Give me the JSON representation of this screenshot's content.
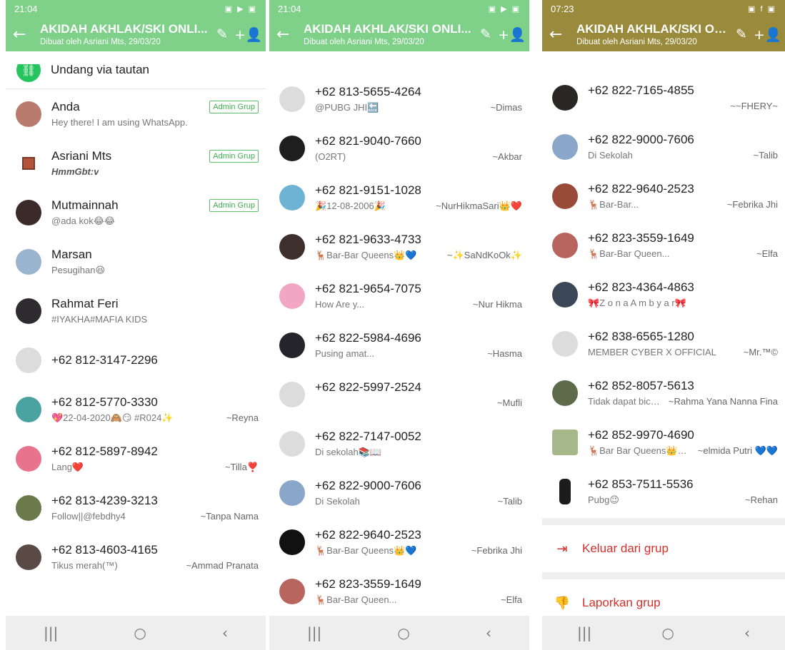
{
  "colors": {
    "header_green": "#7fd18a",
    "header_olive": "#9a8a3c",
    "admin_badge": "#3fae51",
    "danger": "#d6312b"
  },
  "icons": {
    "back": "←",
    "edit": "✎",
    "add_person": "+👤",
    "link": "⛓",
    "nav_recent": "|||",
    "nav_home": "○",
    "nav_back": "‹",
    "exit": "⇥",
    "report": "👎"
  },
  "phones": [
    {
      "time": "21:04",
      "status_icons": "▣ ▶ ▣",
      "title": "AKIDAH AKHLAK/SKI ONLI...",
      "subtitle": "Dibuat oleh Asriani Mts, 29/03/20",
      "invite_label": "Undang via tautan",
      "members": [
        {
          "name": "Anda",
          "status": "Hey there! I am using WhatsApp.",
          "badge": "Admin Grup",
          "alias": ""
        },
        {
          "name": "Asriani Mts",
          "status": "HmmGbt:v",
          "badge": "Admin Grup",
          "alias": ""
        },
        {
          "name": "Mutmainnah",
          "status": "@ada kok😂😂",
          "badge": "Admin Grup",
          "alias": ""
        },
        {
          "name": "Marsan",
          "status": "Pesugihan😆",
          "badge": "",
          "alias": ""
        },
        {
          "name": "Rahmat Feri",
          "status": "#IYAKHA#MAFIA KIDS",
          "badge": "",
          "alias": ""
        },
        {
          "name": "+62 812-3147-2296",
          "status": "",
          "badge": "",
          "alias": ""
        },
        {
          "name": "+62 812-5770-3330",
          "status": "💖22-04-2020🙈😏 #R024✨",
          "badge": "",
          "alias": "~Reyna"
        },
        {
          "name": "+62 812-5897-8942",
          "status": "Lang❤️",
          "badge": "",
          "alias": "~Tilla❣️"
        },
        {
          "name": "+62 813-4239-3213",
          "status": "Follow||@febdhy4",
          "badge": "",
          "alias": "~Tanpa Nama"
        },
        {
          "name": "+62 813-4603-4165",
          "status": "Tikus merah(™)",
          "badge": "",
          "alias": "~Ammad Pranata"
        }
      ]
    },
    {
      "time": "21:04",
      "status_icons": "▣ ▶ ▣",
      "title": "AKIDAH AKHLAK/SKI ONLI...",
      "subtitle": "Dibuat oleh Asriani Mts, 29/03/20",
      "members": [
        {
          "name": "+62 813-5655-4264",
          "status": "@PUBG JHI🔙",
          "alias": "~Dimas"
        },
        {
          "name": "+62 821-9040-7660",
          "status": "(O2RT)",
          "alias": "~Akbar"
        },
        {
          "name": "+62 821-9151-1028",
          "status": "🎉12-08-2006🎉",
          "alias": "~NurHikmaSari👑❤️"
        },
        {
          "name": "+62 821-9633-4733",
          "status": "🦌Bar-Bar Queens👑💙",
          "alias": "~✨SaNdKoOk✨"
        },
        {
          "name": "+62 821-9654-7075",
          "status": "How Are y...",
          "alias": "~Nur Hikma"
        },
        {
          "name": "+62 822-5984-4696",
          "status": "Pusing amat...",
          "alias": "~Hasma"
        },
        {
          "name": "+62 822-5997-2524",
          "status": "",
          "alias": "~Mufli"
        },
        {
          "name": "+62 822-7147-0052",
          "status": "Di sekolah📚📖",
          "alias": ""
        },
        {
          "name": "+62 822-9000-7606",
          "status": "Di Sekolah",
          "alias": "~Talib"
        },
        {
          "name": "+62 822-9640-2523",
          "status": "🦌Bar-Bar Queens👑💙",
          "alias": "~Febrika Jhi"
        },
        {
          "name": "+62 823-3559-1649",
          "status": "🦌Bar-Bar Queen...",
          "alias": "~Elfa"
        }
      ]
    },
    {
      "time": "07:23",
      "status_icons": "▣ f ▣",
      "title": "AKIDAH AKHLAK/SKI ONLI...",
      "subtitle": "Dibuat oleh Asriani Mts, 29/03/20",
      "members": [
        {
          "name": "+62 822-7165-4855",
          "status": "",
          "alias": "~~FHERY~"
        },
        {
          "name": "+62 822-9000-7606",
          "status": "Di Sekolah",
          "alias": "~Talib"
        },
        {
          "name": "+62 822-9640-2523",
          "status": "🦌Bar-Bar...",
          "alias": "~Febrika Jhi"
        },
        {
          "name": "+62 823-3559-1649",
          "status": "🦌Bar-Bar Queen...",
          "alias": "~Elfa"
        },
        {
          "name": "+62 823-4364-4863",
          "status": "🎀Z o n a A m b y a r🎀",
          "alias": ""
        },
        {
          "name": "+62 838-6565-1280",
          "status": "MEMBER CYBER X OFFICIAL",
          "alias": "~Mr.™©"
        },
        {
          "name": "+62 852-8057-5613",
          "status": "Tidak dapat bicara,...",
          "alias": "~Rahma Yana Nanna Fina"
        },
        {
          "name": "+62 852-9970-4690",
          "status": "🦌Bar Bar Queens👑💙🍁",
          "alias": "~elmida Putri 💙💙"
        },
        {
          "name": "+62 853-7511-5536",
          "status": "Pubg😉",
          "alias": "~Rehan"
        }
      ],
      "actions": {
        "exit_label": "Keluar dari grup",
        "report_label": "Laporkan grup"
      }
    }
  ]
}
